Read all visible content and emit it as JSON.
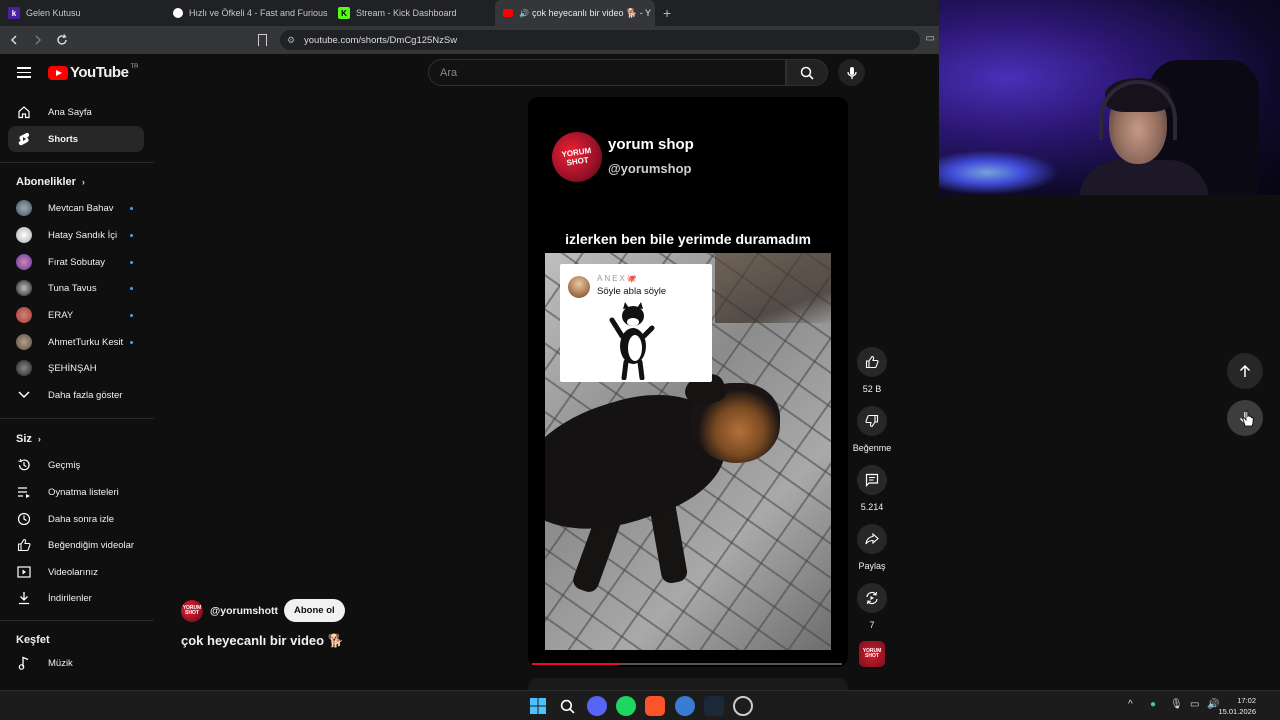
{
  "browser": {
    "tabs": [
      {
        "label": "Gelen Kutusu",
        "icon": "kick-k-icon",
        "active": false
      },
      {
        "label": "Hızlı ve Öfkeli 4 - Fast and Furious 4",
        "icon": "github-icon",
        "active": false
      },
      {
        "label": "Stream - Kick Dashboard",
        "icon": "kick-icon",
        "active": false
      },
      {
        "label": "çok heyecanlı bir video 🐕 - Y",
        "icon": "youtube-icon",
        "active": true
      }
    ],
    "url": "youtube.com/shorts/DmCg125NzSw"
  },
  "youtube": {
    "logo_text": "YouTube",
    "country_code": "TR",
    "search_placeholder": "Ara"
  },
  "sidebar": {
    "main": [
      {
        "label": "Ana Sayfa",
        "icon": "home-icon"
      },
      {
        "label": "Shorts",
        "icon": "shorts-icon",
        "active": true
      }
    ],
    "subscriptions_title": "Abonelikler",
    "subscriptions": [
      {
        "label": "Mevtcan Bahav"
      },
      {
        "label": "Hatay Sandık İçi"
      },
      {
        "label": "Fırat Sobutay"
      },
      {
        "label": "Tuna Tavus"
      },
      {
        "label": "ERAY"
      },
      {
        "label": "AhmetTurku Kesit"
      },
      {
        "label": "ŞEHİNŞAH"
      }
    ],
    "show_more": "Daha fazla göster",
    "you_title": "Siz",
    "you_items": [
      {
        "label": "Geçmiş",
        "icon": "history-icon"
      },
      {
        "label": "Oynatma listeleri",
        "icon": "playlist-icon"
      },
      {
        "label": "Daha sonra izle",
        "icon": "clock-icon"
      },
      {
        "label": "Beğendiğim videolar",
        "icon": "like-icon"
      },
      {
        "label": "Videolarınız",
        "icon": "video-icon"
      },
      {
        "label": "İndirilenler",
        "icon": "download-icon"
      }
    ],
    "explore_title": "Keşfet",
    "explore_items": [
      {
        "label": "Müzik",
        "icon": "music-icon"
      }
    ]
  },
  "short": {
    "overlay_channel": "yorum shop",
    "overlay_handle": "@yorumshop",
    "logo_line1": "YORUM",
    "logo_line2": "SHOT",
    "caption": "izlerken ben bile yerimde duramadım",
    "comment_user": "ANEX🐙",
    "comment_text": "Söyle abla söyle",
    "progress": 0.28,
    "channel_handle": "@yorumshott",
    "subscribe_label": "Abone ol",
    "title": "çok heyecanlı bir video 🐕"
  },
  "actions": {
    "likes": "52 B",
    "dislike_label": "Beğenme",
    "comments": "5.214",
    "share_label": "Paylaş",
    "remix_count": "7"
  },
  "taskbar": {
    "time": "17:02",
    "date": "15.01.2026"
  },
  "colors": {
    "accent": "#ff0000",
    "progress": "#ff0033",
    "background": "#0f0f0f"
  }
}
